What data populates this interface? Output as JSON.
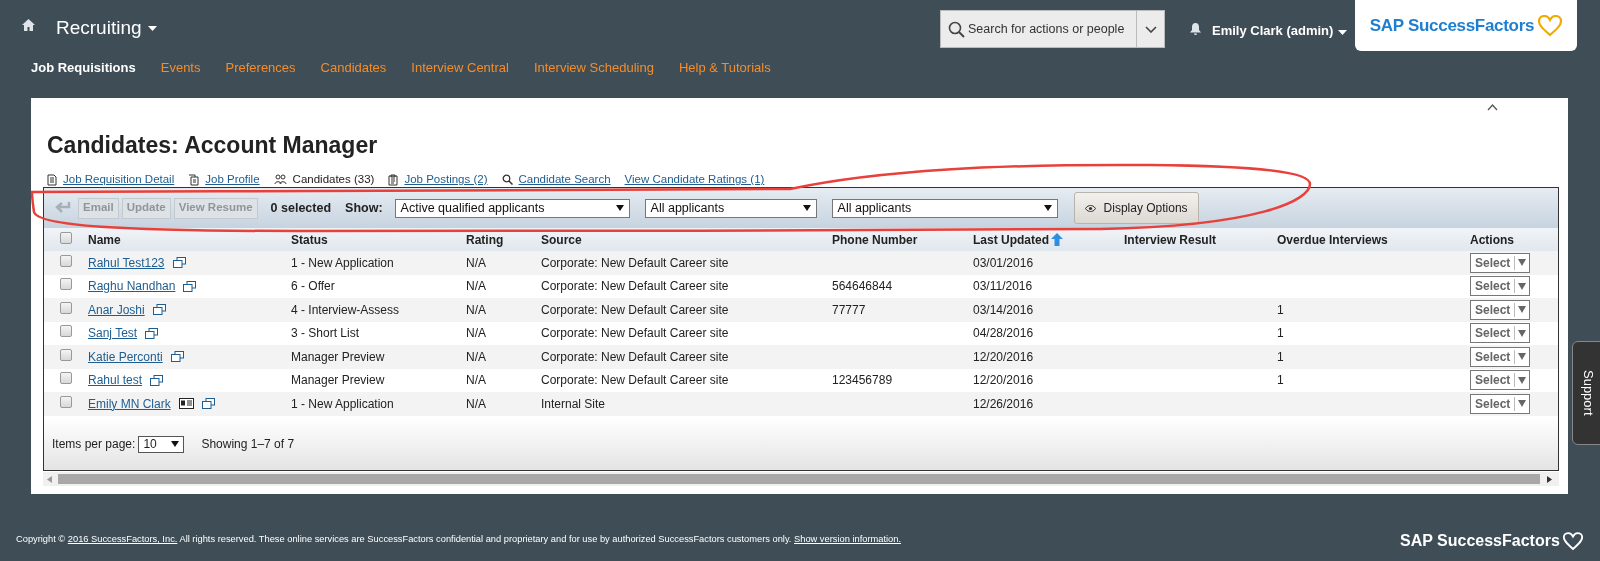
{
  "header": {
    "module": "Recruiting",
    "search": {
      "placeholder": "Search for actions or people"
    },
    "user": "Emily Clark (admin)",
    "logo": "SAP SuccessFactors"
  },
  "nav": [
    {
      "label": "Job Requisitions",
      "selected": true
    },
    {
      "label": "Events",
      "selected": false
    },
    {
      "label": "Preferences",
      "selected": false
    },
    {
      "label": "Candidates",
      "selected": false
    },
    {
      "label": "Interview Central",
      "selected": false
    },
    {
      "label": "Interview Scheduling",
      "selected": false
    },
    {
      "label": "Help & Tutorials",
      "selected": false
    }
  ],
  "page": {
    "title": "Candidates: Account Manager",
    "links": [
      {
        "label": "Job Requisition Detail",
        "selected": false
      },
      {
        "label": "Job Profile",
        "selected": false
      },
      {
        "label": "Candidates (33)",
        "selected": true
      },
      {
        "label": "Job Postings (2)",
        "selected": false
      },
      {
        "label": "Candidate Search",
        "selected": false
      },
      {
        "label": "View Candidate Ratings (1)",
        "selected": false
      }
    ]
  },
  "toolbar": {
    "buttons": [
      {
        "label": "Email",
        "disabled": true
      },
      {
        "label": "Update",
        "disabled": true
      },
      {
        "label": "View Resume",
        "disabled": true
      }
    ],
    "selected_count": "0 selected",
    "show_label": "Show:",
    "filters": [
      {
        "value": "Active qualified applicants"
      },
      {
        "value": "All applicants"
      },
      {
        "value": "All applicants"
      }
    ],
    "display_options": "Display Options"
  },
  "table": {
    "select_all": {
      "checked": false
    },
    "columns": [
      {
        "label": "Name",
        "sorted": false
      },
      {
        "label": "Status",
        "sorted": false
      },
      {
        "label": "Rating",
        "sorted": false
      },
      {
        "label": "Source",
        "sorted": false
      },
      {
        "label": "Phone Number",
        "sorted": false
      },
      {
        "label": "Last Updated",
        "sorted": true
      },
      {
        "label": "Interview Result",
        "sorted": false
      },
      {
        "label": "Overdue Interviews",
        "sorted": false
      },
      {
        "label": "Actions",
        "sorted": false
      }
    ],
    "rows": [
      {
        "checked": false,
        "name": "Rahul Test123",
        "resume_icon": false,
        "status": "1 - New Application",
        "rating": "N/A",
        "source": "Corporate: New Default Career site",
        "last_updated": "03/01/2016",
        "action": "Select"
      },
      {
        "checked": false,
        "name": "Raghu Nandhan",
        "resume_icon": false,
        "status": "6 - Offer",
        "rating": "N/A",
        "source": "Corporate: New Default Career site",
        "phone": "564646844",
        "last_updated": "03/11/2016",
        "action": "Select"
      },
      {
        "checked": false,
        "name": "Anar Joshi",
        "resume_icon": false,
        "status": "4 - Interview-Assess",
        "rating": "N/A",
        "source": "Corporate: New Default Career site",
        "phone": "77777",
        "last_updated": "03/14/2016",
        "overdue": "1",
        "action": "Select"
      },
      {
        "checked": false,
        "name": "Sanj Test",
        "resume_icon": false,
        "status": "3 - Short List",
        "rating": "N/A",
        "source": "Corporate: New Default Career site",
        "last_updated": "04/28/2016",
        "overdue": "1",
        "action": "Select"
      },
      {
        "checked": false,
        "name": "Katie Perconti",
        "resume_icon": false,
        "status": "Manager Preview",
        "rating": "N/A",
        "source": "Corporate: New Default Career site",
        "last_updated": "12/20/2016",
        "overdue": "1",
        "action": "Select"
      },
      {
        "checked": false,
        "name": "Rahul test",
        "resume_icon": false,
        "status": "Manager Preview",
        "rating": "N/A",
        "source": "Corporate: New Default Career site",
        "phone": "123456789",
        "last_updated": "12/20/2016",
        "overdue": "1",
        "action": "Select"
      },
      {
        "checked": false,
        "name": "Emily MN Clark",
        "resume_icon": true,
        "status": "1 - New Application",
        "rating": "N/A",
        "source": "Internal Site",
        "last_updated": "12/26/2016",
        "action": "Select"
      }
    ]
  },
  "pager": {
    "label": "Items per page:",
    "value": "10",
    "showing": "Showing 1–7 of 7"
  },
  "footer": {
    "parts": [
      {
        "kind": "text",
        "text": "Copyright © "
      },
      {
        "kind": "link",
        "text": "2016 SuccessFactors, Inc."
      },
      {
        "kind": "text",
        "text": " All rights reserved. These online services are SuccessFactors confidential and proprietary and for use by authorized SuccessFactors customers only. "
      },
      {
        "kind": "link",
        "text": "Show version information."
      }
    ],
    "logo": "SAP SuccessFactors"
  },
  "support_tab": "Support"
}
